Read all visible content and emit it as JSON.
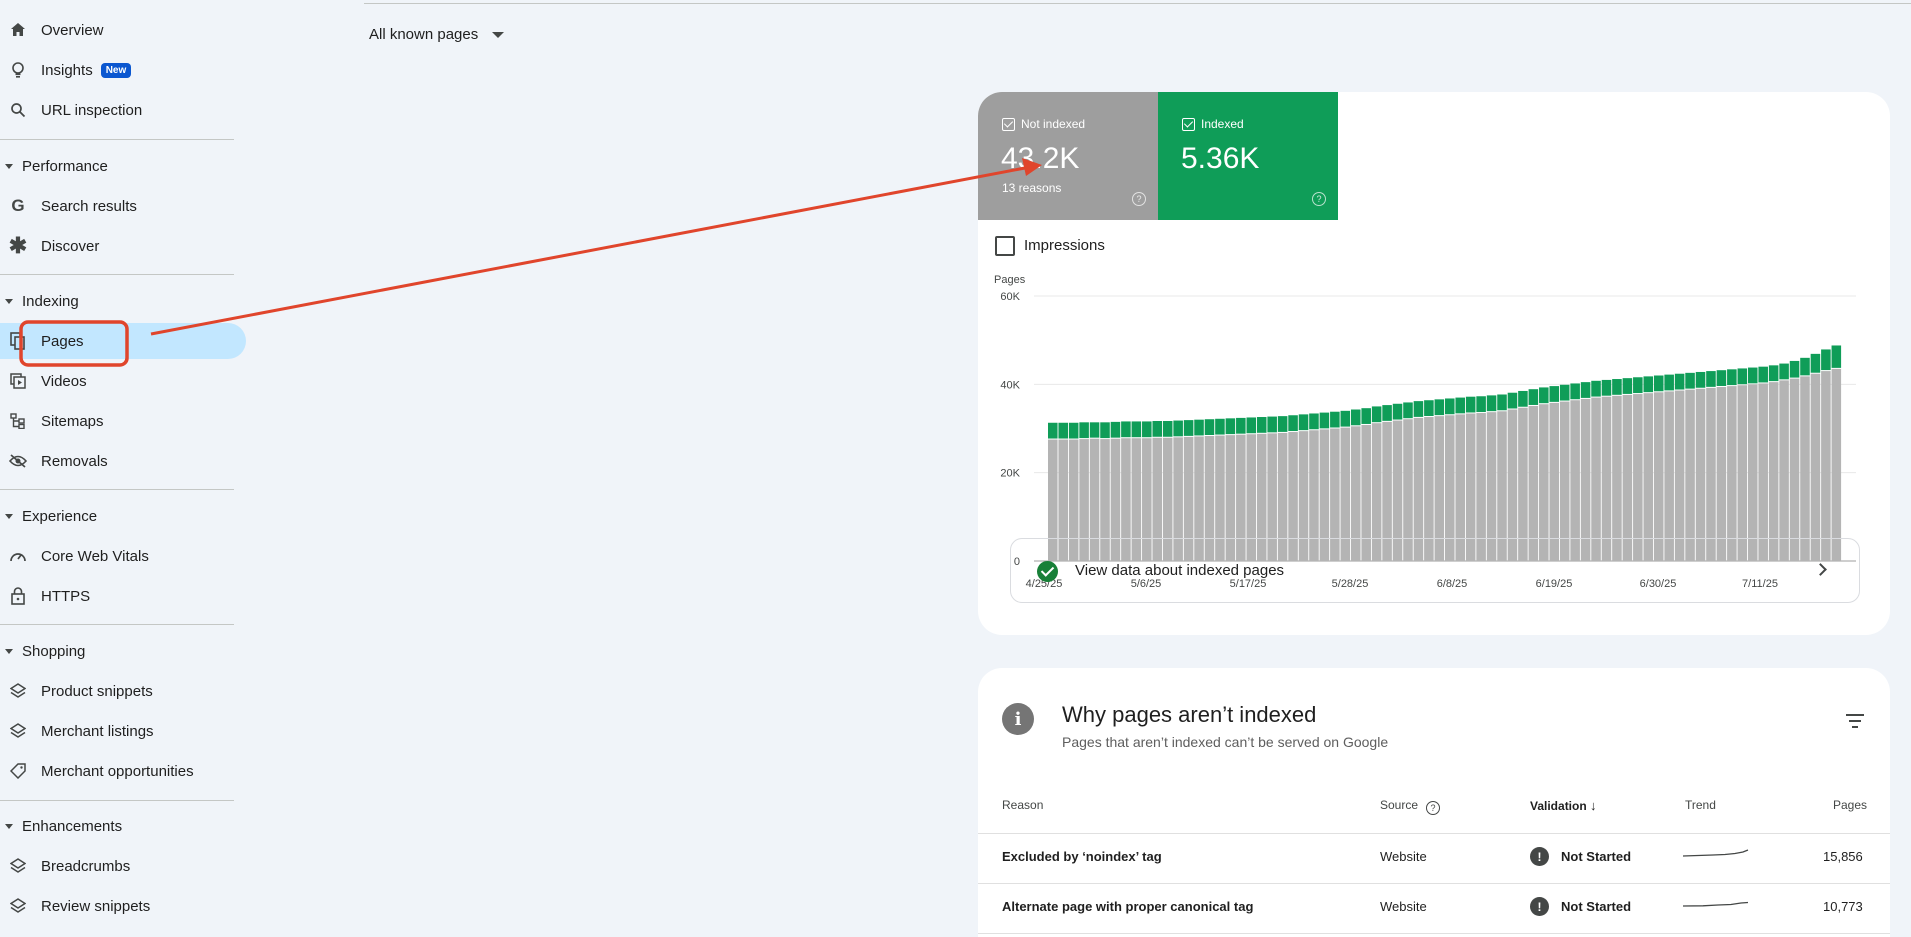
{
  "sidebar": {
    "top_items": [
      {
        "label": "Overview",
        "icon": "home-icon"
      },
      {
        "label": "Insights",
        "icon": "lightbulb-icon",
        "badge": "New"
      },
      {
        "label": "URL inspection",
        "icon": "search-icon"
      }
    ],
    "sections": [
      {
        "title": "Performance",
        "items": [
          {
            "label": "Search results",
            "icon": "google-g-icon"
          },
          {
            "label": "Discover",
            "icon": "asterisk-icon"
          }
        ]
      },
      {
        "title": "Indexing",
        "items": [
          {
            "label": "Pages",
            "icon": "pages-icon",
            "active": true
          },
          {
            "label": "Videos",
            "icon": "video-icon"
          },
          {
            "label": "Sitemaps",
            "icon": "sitemap-icon"
          },
          {
            "label": "Removals",
            "icon": "eye-off-icon"
          }
        ]
      },
      {
        "title": "Experience",
        "items": [
          {
            "label": "Core Web Vitals",
            "icon": "gauge-icon"
          },
          {
            "label": "HTTPS",
            "icon": "lock-icon"
          }
        ]
      },
      {
        "title": "Shopping",
        "items": [
          {
            "label": "Product snippets",
            "icon": "layers-icon"
          },
          {
            "label": "Merchant listings",
            "icon": "layers-icon"
          },
          {
            "label": "Merchant opportunities",
            "icon": "tag-icon"
          }
        ]
      },
      {
        "title": "Enhancements",
        "items": [
          {
            "label": "Breadcrumbs",
            "icon": "layers-icon"
          },
          {
            "label": "Review snippets",
            "icon": "layers-icon"
          }
        ]
      }
    ]
  },
  "page_filter": {
    "label": "All known pages"
  },
  "summary": {
    "not_indexed": {
      "label": "Not indexed",
      "value": "43.2K",
      "sub": "13 reasons",
      "color": "#9e9e9e"
    },
    "indexed": {
      "label": "Indexed",
      "value": "5.36K",
      "color": "#0f9d58"
    },
    "impressions_label": "Impressions",
    "view_data_label": "View data about indexed pages"
  },
  "chart_data": {
    "type": "bar",
    "stacked": true,
    "ylabel": "Pages",
    "ylim": [
      0,
      60000
    ],
    "yticks": [
      "0",
      "20K",
      "40K",
      "60K"
    ],
    "xticks": [
      "4/25/25",
      "5/6/25",
      "5/17/25",
      "5/28/25",
      "6/8/25",
      "6/19/25",
      "6/30/25",
      "7/11/25"
    ],
    "grid": true,
    "series": [
      {
        "color": "#b4b4b4",
        "values": [
          27500,
          27500,
          27500,
          27600,
          27700,
          27600,
          27700,
          27800,
          27800,
          27800,
          27900,
          27900,
          28000,
          28100,
          28200,
          28300,
          28400,
          28500,
          28600,
          28700,
          28800,
          28900,
          29000,
          29200,
          29400,
          29600,
          29800,
          30000,
          30200,
          30500,
          30800,
          31200,
          31500,
          31800,
          32100,
          32400,
          32600,
          32800,
          33000,
          33200,
          33400,
          33500,
          33700,
          33900,
          34300,
          34700,
          35100,
          35500,
          35800,
          36100,
          36400,
          36700,
          37000,
          37200,
          37400,
          37600,
          37800,
          38000,
          38200,
          38400,
          38600,
          38800,
          39000,
          39200,
          39400,
          39600,
          39800,
          40000,
          40200,
          40500,
          40900,
          41300,
          41800,
          42400,
          43000,
          43500
        ]
      },
      {
        "color": "#0f9d58",
        "values": [
          3800,
          3800,
          3800,
          3800,
          3700,
          3800,
          3800,
          3800,
          3800,
          3800,
          3800,
          3800,
          3800,
          3800,
          3800,
          3800,
          3800,
          3800,
          3800,
          3800,
          3800,
          3800,
          3800,
          3800,
          3800,
          3800,
          3800,
          3800,
          3800,
          3800,
          3800,
          3800,
          3800,
          3800,
          3800,
          3800,
          3800,
          3800,
          3800,
          3800,
          3800,
          3800,
          3800,
          3800,
          3800,
          3800,
          3800,
          3800,
          3800,
          3800,
          3800,
          3800,
          3800,
          3800,
          3800,
          3800,
          3800,
          3800,
          3800,
          3800,
          3800,
          3800,
          3800,
          3800,
          3800,
          3800,
          3800,
          3800,
          3800,
          3800,
          3800,
          4000,
          4200,
          4500,
          4900,
          5300
        ]
      }
    ]
  },
  "why": {
    "title": "Why pages aren’t indexed",
    "subtitle": "Pages that aren’t indexed can’t be served on Google",
    "columns": {
      "reason": "Reason",
      "source": "Source",
      "validation": "Validation",
      "trend": "Trend",
      "pages": "Pages"
    },
    "rows": [
      {
        "reason": "Excluded by ‘noindex’ tag",
        "source": "Website",
        "validation": "Not Started",
        "pages": "15,856"
      },
      {
        "reason": "Alternate page with proper canonical tag",
        "source": "Website",
        "validation": "Not Started",
        "pages": "10,773"
      }
    ]
  },
  "annotation": {
    "color": "#e0452c"
  }
}
